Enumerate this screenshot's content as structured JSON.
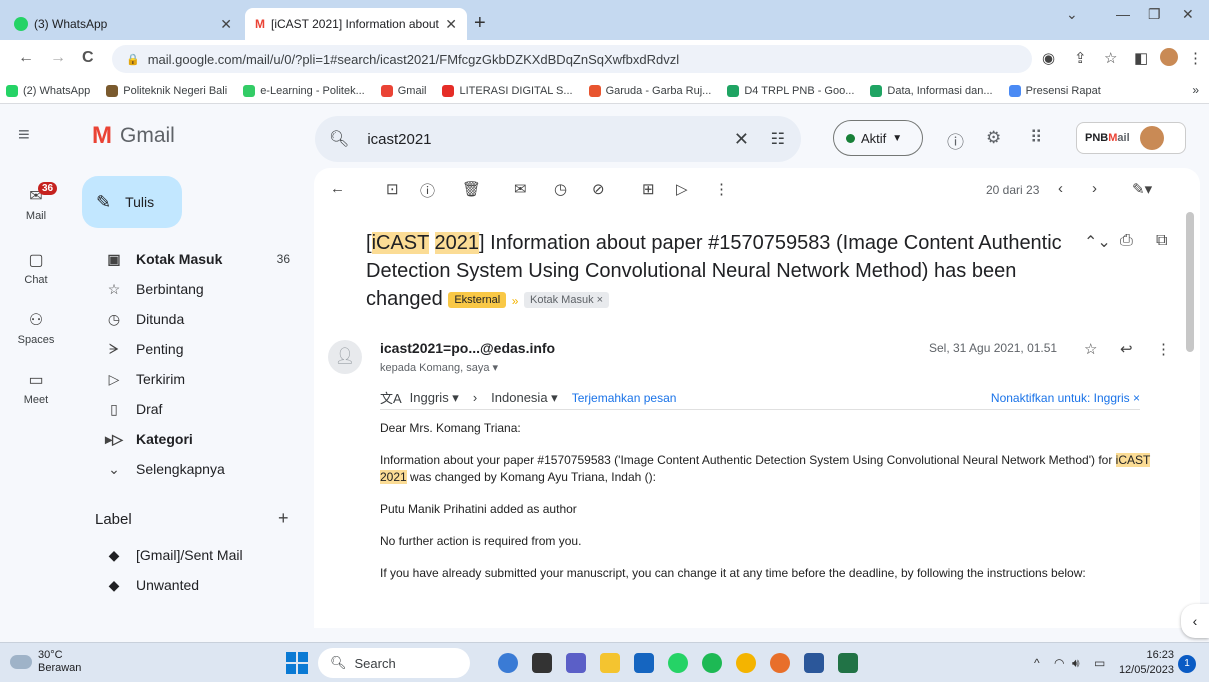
{
  "browser": {
    "tabs": [
      {
        "label": "(3) WhatsApp",
        "icon": "whatsapp-icon"
      },
      {
        "label": "[iCAST 2021] Information about",
        "icon": "gmail-icon"
      }
    ],
    "url": "mail.google.com/mail/u/0/?pli=1#search/icast2021/FMfcgzGkbDZKXdBDqZnSqXwfbxdRdvzl",
    "bookmarks": [
      {
        "label": "(2) WhatsApp",
        "color": "#25d366"
      },
      {
        "label": "Politeknik Negeri Bali",
        "color": "#7a5a2e"
      },
      {
        "label": "e-Learning - Politek...",
        "color": "#3c6"
      },
      {
        "label": "Gmail",
        "color": "#ea4335"
      },
      {
        "label": "LITERASI DIGITAL S...",
        "color": "#e52d27"
      },
      {
        "label": "Garuda - Garba Ruj...",
        "color": "#e8542f"
      },
      {
        "label": "D4 TRPL PNB - Goo...",
        "color": "#1fa463"
      },
      {
        "label": "Data, Informasi dan...",
        "color": "#1fa463"
      },
      {
        "label": "Presensi Rapat",
        "color": "#4a8af4"
      }
    ],
    "more": "»"
  },
  "gmail": {
    "logo": "Gmail",
    "search_value": "icast2021",
    "status": "Aktif",
    "pnb_a": "PNB",
    "pnb_b": "M",
    "pnb_c": "ail"
  },
  "rail": {
    "mail": "Mail",
    "mail_badge": "36",
    "chat": "Chat",
    "spaces": "Spaces",
    "meet": "Meet"
  },
  "sidebar": {
    "compose": "Tulis",
    "items": [
      {
        "label": "Kotak Masuk",
        "count": "36",
        "icon": "▣"
      },
      {
        "label": "Berbintang",
        "count": "",
        "icon": "☆"
      },
      {
        "label": "Ditunda",
        "count": "",
        "icon": "◷"
      },
      {
        "label": "Penting",
        "count": "",
        "icon": "ᗒ"
      },
      {
        "label": "Terkirim",
        "count": "",
        "icon": "▷"
      },
      {
        "label": "Draf",
        "count": "",
        "icon": "▯"
      },
      {
        "label": "Kategori",
        "count": "",
        "icon": "▸▷"
      },
      {
        "label": "Selengkapnya",
        "count": "",
        "icon": "⌄"
      }
    ],
    "label_header": "Label",
    "labels": [
      "[Gmail]/Sent Mail",
      "Unwanted"
    ]
  },
  "message": {
    "pager": "20 dari 23",
    "subject_pre": "[",
    "subject_hl1": "iCAST",
    "subject_sp": " ",
    "subject_hl2": "2021",
    "subject_rest": "] Information about paper #1570759583 (Image Content Authentic Detection System Using Convolutional Neural Network Method) has been changed",
    "tag_external": "Eksternal",
    "tag_inbox": "Kotak Masuk ×",
    "sender": "icast2021=po...@edas.info",
    "to": "kepada Komang, saya ▾",
    "date": "Sel, 31 Agu 2021, 01.51",
    "tr_from": "Inggris ▾",
    "tr_to": "Indonesia ▾",
    "tr_link": "Terjemahkan pesan",
    "tr_off": "Nonaktifkan untuk: Inggris ×",
    "body_greeting": "Dear Mrs. Komang Triana:",
    "body_p1a": "Information about your paper #1570759583 ('Image Content Authentic Detection System Using Convolutional Neural Network Method') for ",
    "body_p1_hl1": "iCAST",
    "body_p1_sp": " ",
    "body_p1_hl2": "2021",
    "body_p1b": " was changed by Komang Ayu Triana, Indah ():",
    "body_p2": "Putu Manik Prihatini added as author",
    "body_p3": "No further action is required from you.",
    "body_p4": "If you have already submitted your manuscript, you can change it at any time before the deadline, by following the instructions below:"
  },
  "taskbar": {
    "temp": "30°C",
    "weather": "Berawan",
    "search": "Search",
    "time": "16:23",
    "date": "12/05/2023",
    "notifications": "1"
  }
}
